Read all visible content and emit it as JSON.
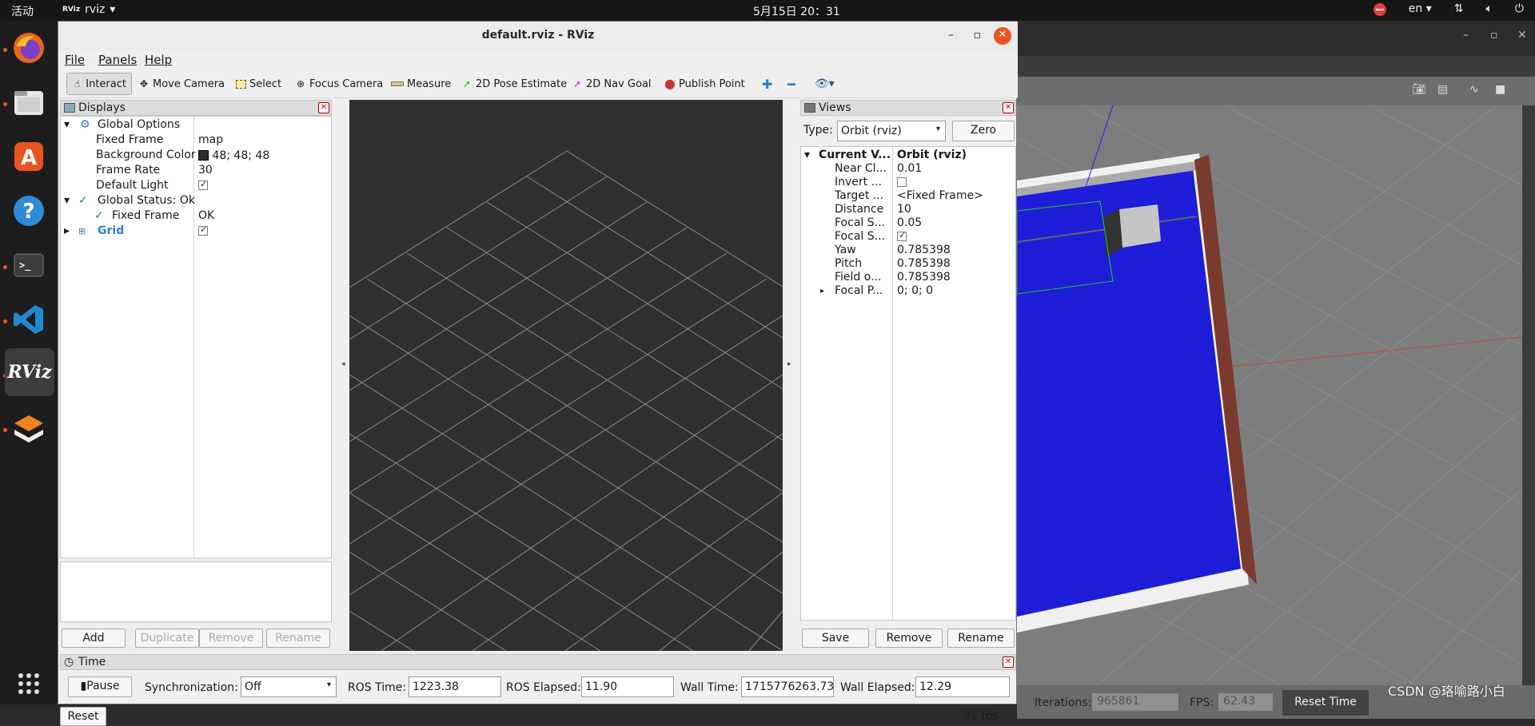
{
  "topbar": {
    "activities": "活动",
    "app_badge": "RViz",
    "app_name": "rviz",
    "clock": "5月15日  20：31",
    "lang": "en"
  },
  "dock": {
    "apps": [
      "Firefox",
      "Files",
      "Ubuntu Software",
      "Help",
      "Terminal",
      "Visual Studio Code",
      "RViz",
      "Gazebo"
    ],
    "rviz_label": "RViz"
  },
  "window": {
    "title": "default.rviz - RViz"
  },
  "menu": {
    "file": "File",
    "panels": "Panels",
    "help": "Help"
  },
  "toolbar": {
    "interact": "Interact",
    "move_camera": "Move Camera",
    "select": "Select",
    "focus_camera": "Focus Camera",
    "measure": "Measure",
    "pose_estimate": "2D Pose Estimate",
    "nav_goal": "2D Nav Goal",
    "publish_point": "Publish Point"
  },
  "displays": {
    "title": "Displays",
    "global_options": "Global Options",
    "fixed_frame_label": "Fixed Frame",
    "fixed_frame_value": "map",
    "bg_color_label": "Background Color",
    "bg_color_value": "48; 48; 48",
    "bg_color_swatch": "#303030",
    "frame_rate_label": "Frame Rate",
    "frame_rate_value": "30",
    "default_light_label": "Default Light",
    "global_status": "Global Status: Ok",
    "status_fixed_frame_label": "Fixed Frame",
    "status_fixed_frame_value": "OK",
    "grid": "Grid",
    "buttons": {
      "add": "Add",
      "duplicate": "Duplicate",
      "remove": "Remove",
      "rename": "Rename"
    }
  },
  "views": {
    "title": "Views",
    "type_label": "Type:",
    "type_value": "Orbit (rviz)",
    "zero": "Zero",
    "current_view_label": "Current V...",
    "current_view_value": "Orbit (rviz)",
    "props": [
      {
        "k": "Near Cl...",
        "v": "0.01"
      },
      {
        "k": "Invert ...",
        "v": ""
      },
      {
        "k": "Target ...",
        "v": "<Fixed Frame>"
      },
      {
        "k": "Distance",
        "v": "10"
      },
      {
        "k": "Focal S...",
        "v": "0.05"
      },
      {
        "k": "Focal S...",
        "v": ""
      },
      {
        "k": "Yaw",
        "v": "0.785398"
      },
      {
        "k": "Pitch",
        "v": "0.785398"
      },
      {
        "k": "Field o...",
        "v": "0.785398"
      },
      {
        "k": "Focal P...",
        "v": "0; 0; 0"
      }
    ],
    "buttons": {
      "save": "Save",
      "remove": "Remove",
      "rename": "Rename"
    }
  },
  "time": {
    "title": "Time",
    "pause": "Pause",
    "sync_label": "Synchronization:",
    "sync_value": "Off",
    "ros_time_label": "ROS Time:",
    "ros_time_value": "1223.38",
    "ros_elapsed_label": "ROS Elapsed:",
    "ros_elapsed_value": "11.90",
    "wall_time_label": "Wall Time:",
    "wall_time_value": "1715776263.73",
    "wall_elapsed_label": "Wall Elapsed:",
    "wall_elapsed_value": "12.29",
    "reset": "Reset",
    "fps": "31 fps"
  },
  "gazebo": {
    "iterations_label": "Iterations:",
    "iterations_value": "965861",
    "fps_label": "FPS:",
    "fps_value": "62.43",
    "reset_time": "Reset Time"
  },
  "watermark": "CSDN @珞喻路小白"
}
